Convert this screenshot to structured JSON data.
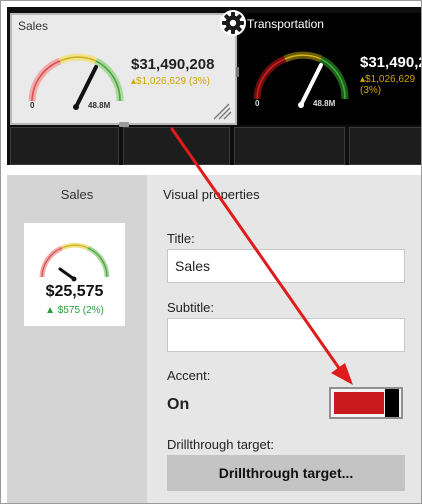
{
  "dashboard": {
    "tiles": [
      {
        "title": "Sales",
        "value": "$31,490,208",
        "delta": "▴$1,026,629 (3%)",
        "gauge_min": "0",
        "gauge_max": "48.8M",
        "theme": "light"
      },
      {
        "title": "Transportation",
        "value": "$31,490,2",
        "delta": "▴$1,026,629 (3%)",
        "gauge_min": "0",
        "gauge_max": "48.8M",
        "theme": "dark"
      }
    ],
    "settings_icon": "gear-icon",
    "resize_icon": "resize-grip-icon"
  },
  "preview": {
    "header": "Sales",
    "value": "$25,575",
    "delta": "▲ $575 (2%)"
  },
  "visual_properties": {
    "heading": "Visual properties",
    "title_label": "Title:",
    "title_value": "Sales",
    "subtitle_label": "Subtitle:",
    "subtitle_value": "",
    "accent_label": "Accent:",
    "accent_state": "On",
    "accent_color": "#c8191c",
    "drillthrough_label": "Drillthrough target:",
    "drillthrough_button": "Drillthrough target..."
  },
  "annotation": {
    "arrow_color": "#e01b1b"
  }
}
